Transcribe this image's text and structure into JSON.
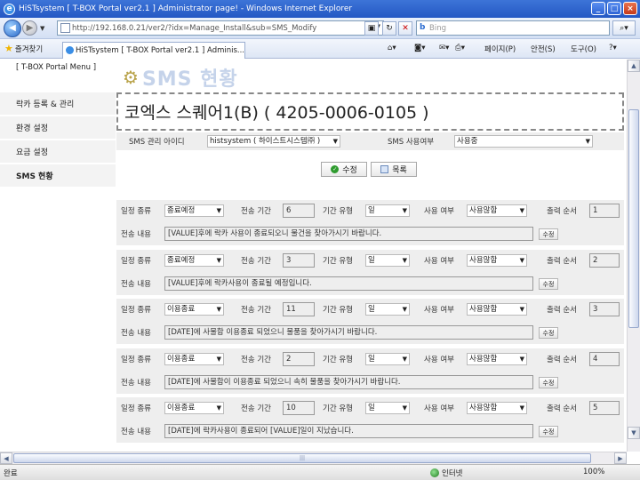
{
  "browser": {
    "title": "HiSTsystem [ T-BOX Portal ver2.1 ] Administrator page! - Windows Internet Explorer",
    "url": "http://192.168.0.21/ver2/?idx=Manage_Install&sub=SMS_Modify",
    "search_placeholder": "Bing",
    "favorites_label": "즐겨찾기",
    "tab_title": "HiSTsystem [ T-BOX Portal ver2.1 ] Adminis...",
    "menu_page": "페이지(P)",
    "menu_safety": "안전(S)",
    "menu_tools": "도구(O)",
    "status_done": "완료",
    "status_zone": "인터넷",
    "status_zoom": "100%"
  },
  "sidebar": {
    "title": "[ T-BOX Portal Menu ]",
    "items": [
      {
        "label": "락카 등록 & 관리"
      },
      {
        "label": "환경 설정"
      },
      {
        "label": "요금 설정"
      },
      {
        "label": "SMS 현황"
      }
    ]
  },
  "page": {
    "heading": "SMS 현황",
    "location_title": "코엑스 스퀘어1(B) ( 4205-0006-0105 )",
    "manager_label": "SMS 관리 아이디",
    "manager_value": "histsystem ( 하이스트시스템㈜ )",
    "use_label": "SMS 사용여부",
    "use_value": "사용중",
    "save_button": "수정",
    "list_button": "목록"
  },
  "labels": {
    "type": "일정 종류",
    "period": "전송 기간",
    "period_type": "기간 유형",
    "usage": "사용 여부",
    "order": "출력 순서",
    "content": "전송 내용",
    "edit": "수정"
  },
  "schedules": [
    {
      "type": "종료예정",
      "period": "6",
      "period_type": "일",
      "usage": "사용않함",
      "order": "1",
      "content": "[VALUE]후에 락카 사용이 종료되오니 물건을 찾아가시기 바랍니다."
    },
    {
      "type": "종료예정",
      "period": "3",
      "period_type": "일",
      "usage": "사용않함",
      "order": "2",
      "content": "[VALUE]후에 락카사용이 종료될 예정입니다."
    },
    {
      "type": "이용종료",
      "period": "11",
      "period_type": "일",
      "usage": "사용않함",
      "order": "3",
      "content": "[DATE]에 사물함 이용종료 되었으니 물품을 찾아가시기 바랍니다."
    },
    {
      "type": "이용종료",
      "period": "2",
      "period_type": "일",
      "usage": "사용않함",
      "order": "4",
      "content": "[DATE]에 사물함이 이용종료 되었으니 속히 물품을 찾아가시기 바랍니다."
    },
    {
      "type": "이용종료",
      "period": "10",
      "period_type": "일",
      "usage": "사용않함",
      "order": "5",
      "content": "[DATE]에 락카사용이 종료되어 [VALUE]일이 지났습니다."
    }
  ]
}
